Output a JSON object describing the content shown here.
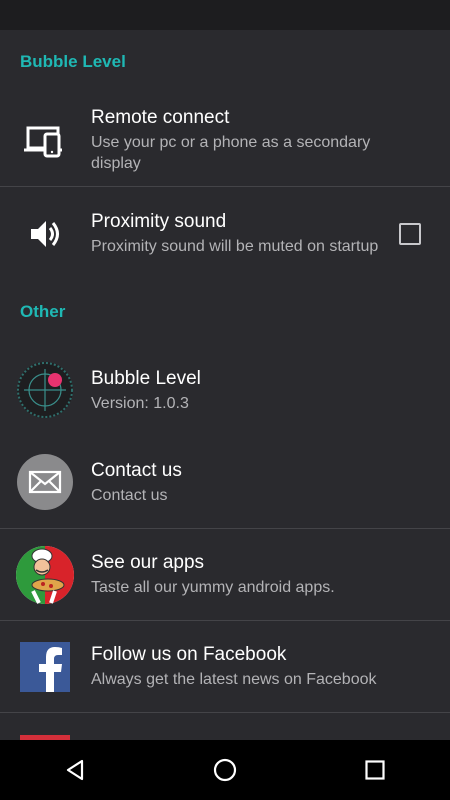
{
  "sections": {
    "bubble_level": {
      "header": "Bubble Level",
      "remote": {
        "title": "Remote connect",
        "summary": "Use your pc or a phone as a secondary display",
        "icon": "laptop-phone-icon"
      },
      "proximity": {
        "title": "Proximity sound",
        "summary": "Proximity sound will be muted on startup",
        "checked": false,
        "icon": "speaker-icon"
      }
    },
    "other": {
      "header": "Other",
      "app": {
        "title": "Bubble Level",
        "summary": "Version: 1.0.3",
        "icon": "bubble-level-app-icon"
      },
      "contact": {
        "title": "Contact us",
        "summary": "Contact us",
        "icon": "mail-icon"
      },
      "apps": {
        "title": "See our apps",
        "summary": "Taste all our yummy android apps.",
        "icon": "chef-pizza-icon"
      },
      "facebook": {
        "title": "Follow us on Facebook",
        "summary": "Always get the latest news on Facebook",
        "icon": "facebook-icon"
      }
    }
  },
  "nav": {
    "back": "back-icon",
    "home": "home-icon",
    "recents": "recents-icon"
  },
  "colors": {
    "accent": "#1fb8b4",
    "background": "#2a2a2e",
    "facebook": "#3b5998",
    "bubble": "#e8336f"
  }
}
